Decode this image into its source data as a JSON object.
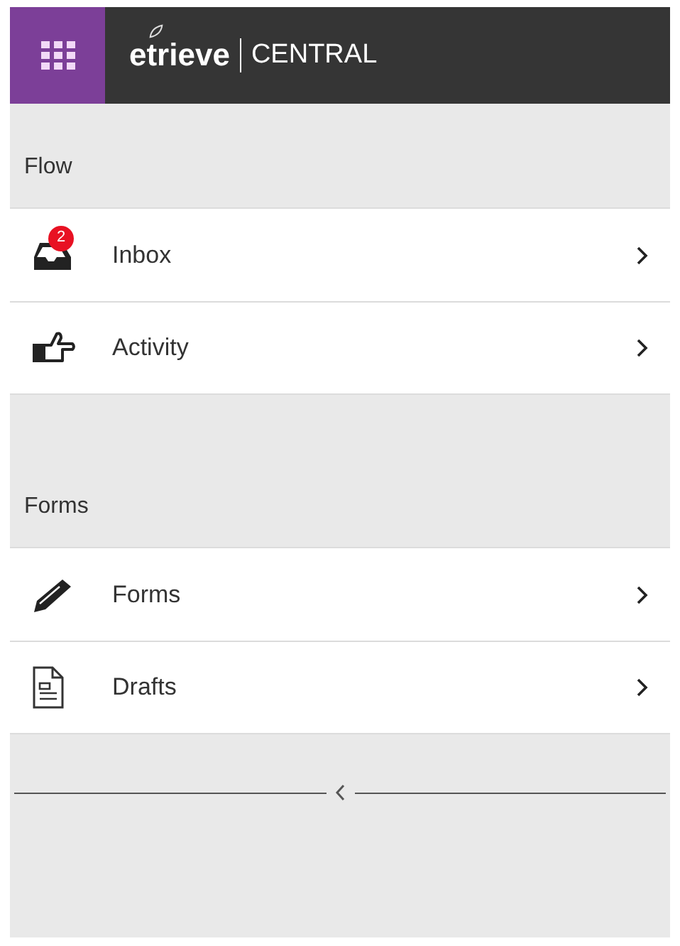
{
  "header": {
    "brand": "etrieve",
    "product": "CENTRAL"
  },
  "sections": [
    {
      "title": "Flow",
      "items": [
        {
          "label": "Inbox",
          "kind": "inbox",
          "badge": "2"
        },
        {
          "label": "Activity",
          "kind": "hand"
        }
      ]
    },
    {
      "title": "Forms",
      "items": [
        {
          "label": "Forms",
          "kind": "pencil"
        },
        {
          "label": "Drafts",
          "kind": "document"
        }
      ]
    }
  ]
}
